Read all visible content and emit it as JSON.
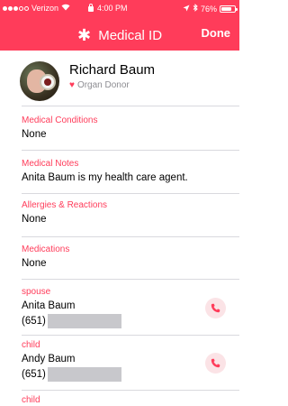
{
  "status_bar": {
    "carrier": "Verizon",
    "time": "4:00 PM",
    "battery_pct": "76%",
    "battery_level": 0.76
  },
  "nav": {
    "title_icon": "✱",
    "title": "Medical ID",
    "done_label": "Done"
  },
  "profile": {
    "name": "Richard Baum",
    "donor_icon": "♥",
    "donor_label": "Organ Donor"
  },
  "sections": [
    {
      "label": "Medical Conditions",
      "value": "None"
    },
    {
      "label": "Medical Notes",
      "value": "Anita Baum is my health care agent."
    },
    {
      "label": "Allergies & Reactions",
      "value": "None"
    },
    {
      "label": "Medications",
      "value": "None"
    }
  ],
  "contacts": [
    {
      "relation": "spouse",
      "name": "Anita Baum",
      "phone_prefix": "(651)"
    },
    {
      "relation": "child",
      "name": "Andy Baum",
      "phone_prefix": "(651)"
    },
    {
      "relation": "child"
    }
  ],
  "colors": {
    "accent": "#ff3c5a",
    "divider": "#d9d9de",
    "call_bg": "#fbe3e6"
  }
}
